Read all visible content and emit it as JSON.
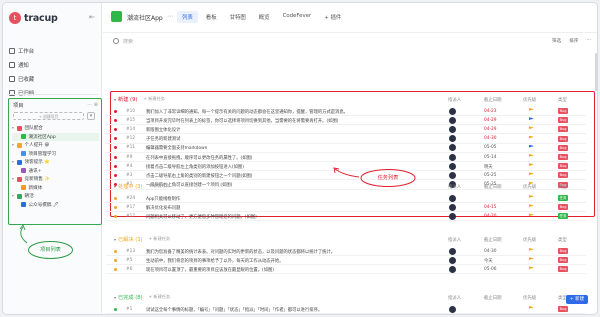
{
  "app": {
    "name": "tracup",
    "logo_letter": "t"
  },
  "sidebar": {
    "nav": [
      {
        "label": "工作台"
      },
      {
        "label": "通知"
      },
      {
        "label": "已收藏"
      },
      {
        "label": "已归档"
      }
    ],
    "projects_title": "项目",
    "projects_tools": "⋯ ⊕",
    "add_project": "+ 创建项目",
    "add_project_icon": "▾",
    "tree": [
      {
        "label": "团队配合",
        "color": "#e9505f",
        "child": false,
        "selected": false
      },
      {
        "label": "潮流社区App",
        "color": "#2fb84a",
        "child": true,
        "selected": true
      },
      {
        "label": "个人提升 😀",
        "color": "#f5a623",
        "child": false,
        "selected": false
      },
      {
        "label": "项目管理学习",
        "color": "#4a90e2",
        "child": true,
        "selected": false
      },
      {
        "label": "领客提示 ⭐",
        "color": "#2e6be6",
        "child": false,
        "selected": false
      },
      {
        "label": "通讯+",
        "color": "#9b59b6",
        "child": true,
        "selected": false
      },
      {
        "label": "竞新销售 ✨",
        "color": "#e9505f",
        "child": false,
        "selected": false
      },
      {
        "label": "新媒体",
        "color": "#f39c12",
        "child": true,
        "selected": false
      },
      {
        "label": "朝活",
        "color": "#27ae60",
        "child": false,
        "selected": false
      },
      {
        "label": "公众号撰稿 🖊",
        "color": "#2e6be6",
        "child": true,
        "selected": false
      }
    ],
    "annotation": "项目列表"
  },
  "header": {
    "project_title": "潮流社区App",
    "more": "⋯",
    "tabs": [
      {
        "label": "列表",
        "active": true
      },
      {
        "label": "看板",
        "active": false
      },
      {
        "label": "甘特图",
        "active": false
      },
      {
        "label": "概览",
        "active": false
      },
      {
        "label": "CodeFever",
        "active": false
      },
      {
        "label": "+ 插件",
        "active": false
      }
    ]
  },
  "search": {
    "placeholder": "搜索"
  },
  "toolbar": {
    "filter": "筛选",
    "sort": "排序",
    "more": "⋯"
  },
  "columns": {
    "assignee": "指派人",
    "due": "截止日期",
    "priority": "优先级",
    "type": "类型"
  },
  "groups": [
    {
      "name": "新建 (9)",
      "color": "#e0202f",
      "add": "+ 新建任务",
      "rows": [
        {
          "dot": "#e0202f",
          "id": "#10",
          "title": "我们加入了非常详细的通知。每一个提示有关的问题的动态都会在这里通知你，提醒，管理的方式是消息。",
          "due": "04-23",
          "due_color": "#e0202f",
          "flag": "#f5a623",
          "tag": "Bug",
          "tag_color": "#e9505f"
        },
        {
          "dot": "#e0202f",
          "id": "#15",
          "title": "当项目开发完毕时在列表上的标签，你可以选择将项目切换到其他，当需要的在将需要再打开。(如图)",
          "due": "04-29",
          "due_color": "#e0202f",
          "flag": "#2e6be6",
          "tag": "Bug",
          "tag_color": "#e9505f"
        },
        {
          "dot": "#e0202f",
          "id": "#14",
          "title": "新版图立体化设计",
          "due": "04-29",
          "due_color": "#e0202f",
          "flag": "#f5a623",
          "tag": "Bug",
          "tag_color": "#e9505f"
        },
        {
          "dot": "#e0202f",
          "id": "#12",
          "title": "子任务的新建测试",
          "due": "04-30",
          "due_color": "#e0202f",
          "flag": "#f5a623",
          "tag": "Bug",
          "tag_color": "#e9505f"
        },
        {
          "dot": "#e0202f",
          "id": "#11",
          "title": "编辑器需要全面支持markdown",
          "due": "05-05",
          "due_color": "#555",
          "flag": "#2e6be6",
          "tag": "Bug",
          "tag_color": "#e9505f"
        },
        {
          "dot": "#e0202f",
          "id": "#9",
          "title": "在列表中直接拖拽，顺序可以更改任务的属性了。(如图)",
          "due": "05-14",
          "due_color": "#555",
          "flag": "#f5a623",
          "tag": "Bug",
          "tag_color": "#e9505f"
        },
        {
          "dot": "#e0202f",
          "id": "#4",
          "title": "接着点击二级导航左上角类别的添加按钮进入(如图)",
          "due": "明天",
          "due_color": "#555",
          "flag": "#f5a623",
          "tag": "Bug",
          "tag_color": "#e9505f"
        },
        {
          "dot": "#e0202f",
          "id": "#3",
          "title": "点击二级导航右上角的类别的新建按钮之一个问题(如图)",
          "due": "05-25",
          "due_color": "#555",
          "flag": "#f5a623",
          "tag": "Bug",
          "tag_color": "#e9505f"
        },
        {
          "dot": "#e0202f",
          "id": "#2",
          "title": "一级导航右上角可以直接创建一个项目 (如图)",
          "due": "05-25",
          "due_color": "#555",
          "flag": "#f5a623",
          "tag": "Bug",
          "tag_color": "#e9505f"
        }
      ]
    },
    {
      "name": "处理中 (3)",
      "color": "#f5a623",
      "add": "+ 新建任务",
      "rows": [
        {
          "dot": "#f5a623",
          "id": "#24",
          "title": "App只能线框制作",
          "due": "",
          "due_color": "#555",
          "flag": "#f5a623",
          "tag": "任务",
          "tag_color": "#2fb84a"
        },
        {
          "dot": "#f5a623",
          "id": "#17",
          "title": "解决优化发布问题",
          "due": "04-15",
          "due_color": "#e0202f",
          "flag": "#f5a623",
          "tag": "Bug",
          "tag_color": "#e9505f"
        },
        {
          "dot": "#f5a623",
          "id": "#17",
          "title": "问题相关可以移动了，更方便您多种管理您的问题。(如图)",
          "due": "04-20",
          "due_color": "#e0202f",
          "flag": "#f5a623",
          "tag": "任务",
          "tag_color": "#2fb84a"
        }
      ]
    },
    {
      "name": "已解决 (3)",
      "color": "#f5a623",
      "add": "+ 新建任务",
      "rows": [
        {
          "dot": "#f5a623",
          "id": "#13",
          "title": "我们为您准备了精美的统计表表。对问题的实时的更新的状态，以及问题的状态都将以统计了统计。",
          "due": "04-30",
          "due_color": "#555",
          "flag": "#f5a623",
          "tag": "Bug",
          "tag_color": "#e9505f"
        },
        {
          "dot": "#f5a623",
          "id": "#5",
          "title": "生动前中，我们将您的项目的事项给予了以外，每天的工作从动态开始。",
          "due": "今天",
          "due_color": "#555",
          "flag": "#f5a623",
          "tag": "Bug",
          "tag_color": "#e9505f"
        },
        {
          "dot": "#f5a623",
          "id": "#6",
          "title": "现在项目可以置顶了，最重要的项目应该放在最显眼的位置。(如图)",
          "due": "05-06",
          "due_color": "#555",
          "flag": "#f5a623",
          "tag": "Bug",
          "tag_color": "#e9505f"
        }
      ]
    },
    {
      "name": "已完成 (8)",
      "color": "#2fb84a",
      "add": "+ 新建任务",
      "rows": [
        {
          "dot": "#2fb84a",
          "id": "#1",
          "title": "试试这全每个事情的标题，「编号」「问题」「状态」「指派」「时间」「作者」都可以进行排序。",
          "due": "",
          "due_color": "#555",
          "flag": "#f5a623",
          "tag": "Bug",
          "tag_color": "#e9505f"
        }
      ]
    }
  ],
  "annotation_tasks": "任务列表",
  "fab": "+ 新建"
}
